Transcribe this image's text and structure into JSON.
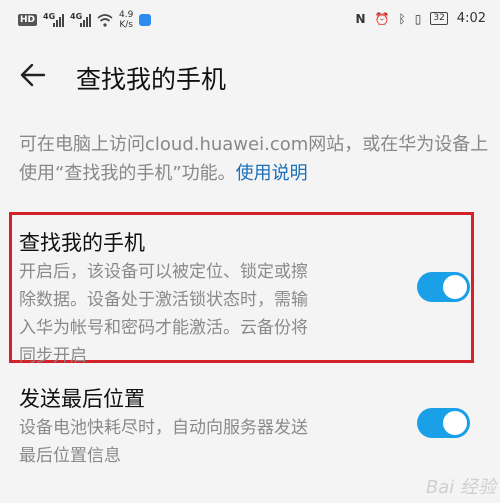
{
  "status_bar": {
    "hd": "HD",
    "net1": "4G",
    "net2": "4G",
    "speed_value": "4.9",
    "speed_unit": "K/s",
    "battery": "32",
    "time": "4:02"
  },
  "header": {
    "title": "查找我的手机"
  },
  "description": {
    "text": "可在电脑上访问cloud.huawei.com网站，或在华为设备上使用“查找我的手机”功能。",
    "link": "使用说明"
  },
  "settings": [
    {
      "title": "查找我的手机",
      "desc_lines": [
        "开启后，该设备可以被定位、锁定或擦",
        "除数据。设备处于激活锁状态时，需输",
        "入华为帐号和密码才能激活。云备份将",
        "同步开启"
      ],
      "enabled": true
    },
    {
      "title": "发送最后位置",
      "desc_lines": [
        "设备电池快耗尽时，自动向服务器发送",
        "最后位置信息"
      ],
      "enabled": true
    }
  ],
  "colors": {
    "accent": "#1aa0e8",
    "link": "#1a6fb7",
    "highlight": "#d3222a"
  },
  "watermark": "Bai 经验"
}
